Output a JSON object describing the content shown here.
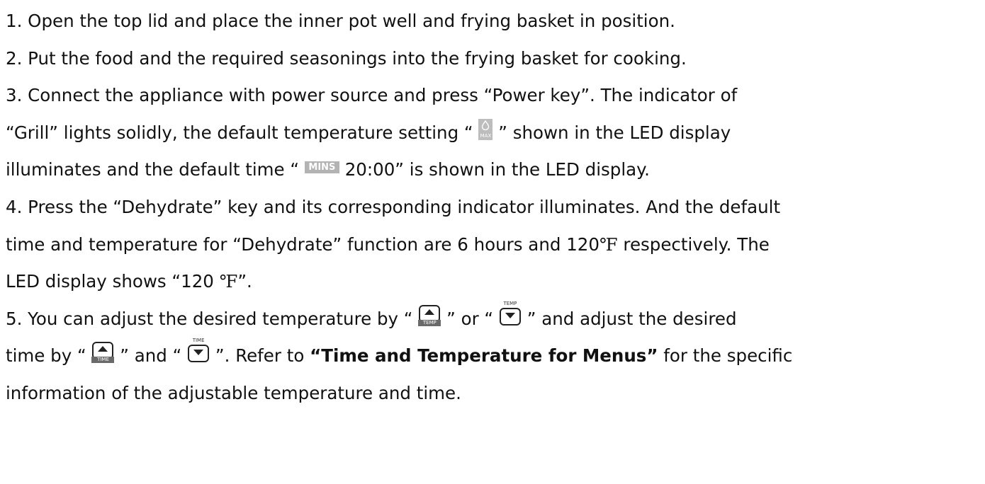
{
  "steps": {
    "s1": "1.  Open the top lid and place the inner pot well and frying basket in position.",
    "s2": "2.  Put the food and the required seasonings into the frying basket for cooking.",
    "s3_line1": "3.  Connect the appliance with power source and press “Power key”. The indicator of",
    "s3_line2_a": "“Grill” lights solidly, the default temperature setting “",
    "s3_line2_b": "” shown in the LED display",
    "s3_line3_a": "illuminates and the default time “",
    "s3_line3_b": "20:00” is shown in the LED display.",
    "s4_line1": "4.  Press the “Dehydrate” key and its corresponding indicator illuminates. And the default",
    "s4_line2_a": "time and temperature for “Dehydrate” function are 6 hours and 120",
    "s4_line2_deg": "℉",
    "s4_line2_b": "  respectively. The",
    "s4_line3_a": "LED display shows “120 ",
    "s4_line3_deg": "℉",
    "s4_line3_b": "”.",
    "s5_line1_a": "5.  You can adjust the desired temperature by “",
    "s5_line1_b": "” or “",
    "s5_line1_c": "” and adjust the desired",
    "s5_line2_a": "time by “",
    "s5_line2_b": "” and “",
    "s5_line2_c": "”. Refer to ",
    "s5_line2_bold": "“Time and Temperature for Menus”",
    "s5_line2_d": " for the specific",
    "s5_line3": "information of the adjustable temperature and time."
  },
  "icons": {
    "max_label": "MAX",
    "mins_label": "MINS",
    "temp_label": "TEMP",
    "time_label": "TIME"
  }
}
